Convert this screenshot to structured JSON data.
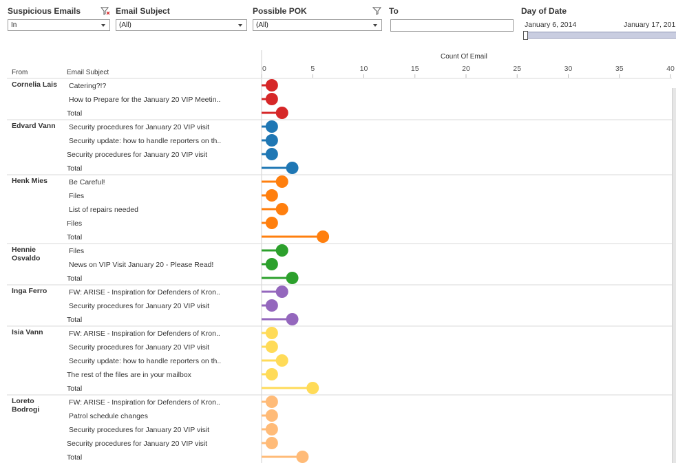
{
  "filters": {
    "suspicious": {
      "title": "Suspicious Emails",
      "value": "In"
    },
    "subject": {
      "title": "Email Subject",
      "value": "(All)"
    },
    "pok": {
      "title": "Possible POK",
      "value": "(All)"
    },
    "to": {
      "title": "To",
      "value": ""
    },
    "date": {
      "title": "Day of Date",
      "start": "January 6, 2014",
      "end": "January 17, 201"
    }
  },
  "headers": {
    "from": "From",
    "subject": "Email Subject",
    "axis_title": "Count Of Email"
  },
  "colors": {
    "Cornelia Lais": "#d62728",
    "Edvard Vann": "#1f77b4",
    "Henk Mies": "#ff7f0e",
    "Hennie Osvaldo": "#2ca02c",
    "Inga Ferro": "#9467bd",
    "Isia Vann": "#ffdb58",
    "Loreto Bodrogi": "#ffbb78"
  },
  "chart_data": {
    "type": "lollipop",
    "xlabel": "Count Of Email",
    "xlim": [
      0,
      40
    ],
    "ticks": [
      0,
      5,
      10,
      15,
      20,
      25,
      30,
      35,
      40
    ],
    "groups": [
      {
        "from": "Cornelia Lais",
        "rows": [
          {
            "subject": "Catering?!?",
            "value": 1
          },
          {
            "subject": "How to Prepare for the January 20 VIP Meetin..",
            "value": 1
          },
          {
            "subject": "Total",
            "value": 2,
            "total": true
          }
        ]
      },
      {
        "from": "Edvard Vann",
        "rows": [
          {
            "subject": "Security procedures for January 20 VIP visit",
            "value": 1
          },
          {
            "subject": "Security update: how to handle reporters on th..",
            "value": 1
          },
          {
            "subject": "Security procedures for January 20 VIP visit",
            "value": 1,
            "flush": true
          },
          {
            "subject": "Total",
            "value": 3,
            "total": true
          }
        ]
      },
      {
        "from": "Henk Mies",
        "rows": [
          {
            "subject": "Be Careful!",
            "value": 2
          },
          {
            "subject": "Files",
            "value": 1
          },
          {
            "subject": "List of repairs needed",
            "value": 2
          },
          {
            "subject": "Files",
            "value": 1,
            "flush": true
          },
          {
            "subject": "Total",
            "value": 6,
            "total": true
          }
        ]
      },
      {
        "from": "Hennie Osvaldo",
        "rows": [
          {
            "subject": "Files",
            "value": 2
          },
          {
            "subject": "News on VIP Visit January 20 - Please Read!",
            "value": 1
          },
          {
            "subject": "Total",
            "value": 3,
            "total": true
          }
        ]
      },
      {
        "from": "Inga Ferro",
        "rows": [
          {
            "subject": "FW: ARISE - Inspiration for Defenders of Kron..",
            "value": 2
          },
          {
            "subject": "Security procedures for January 20 VIP visit",
            "value": 1
          },
          {
            "subject": "Total",
            "value": 3,
            "total": true
          }
        ]
      },
      {
        "from": "Isia Vann",
        "rows": [
          {
            "subject": "FW: ARISE - Inspiration for Defenders of Kron..",
            "value": 1
          },
          {
            "subject": "Security procedures for January 20 VIP visit",
            "value": 1
          },
          {
            "subject": "Security update: how to handle reporters on th..",
            "value": 2
          },
          {
            "subject": "The rest of the files are in your mailbox",
            "value": 1,
            "flush": true
          },
          {
            "subject": "Total",
            "value": 5,
            "total": true
          }
        ]
      },
      {
        "from": "Loreto Bodrogi",
        "rows": [
          {
            "subject": "FW: ARISE - Inspiration for Defenders of Kron..",
            "value": 1
          },
          {
            "subject": "Patrol schedule changes",
            "value": 1
          },
          {
            "subject": "Security procedures for January 20 VIP visit",
            "value": 1
          },
          {
            "subject": "Security procedures for January 20 VIP visit",
            "value": 1,
            "flush": true
          },
          {
            "subject": "Total",
            "value": 4,
            "total": true
          }
        ]
      }
    ]
  }
}
